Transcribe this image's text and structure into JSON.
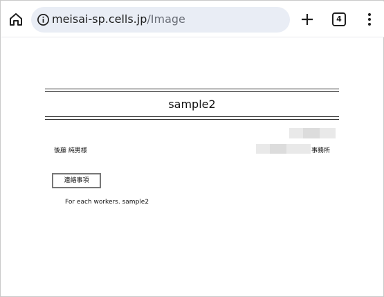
{
  "browser": {
    "url_host": "meisai-sp.cells.jp",
    "url_path": "/Image",
    "tab_count": "4"
  },
  "document": {
    "title": "sample2",
    "recipient": "後藤 純男様",
    "office_suffix": "事務所",
    "contact_button": "連絡事項",
    "note": "For each workers. sample2"
  },
  "colors": {
    "accent_omnibox": "#e9edf5",
    "text": "#1f1f1f"
  }
}
